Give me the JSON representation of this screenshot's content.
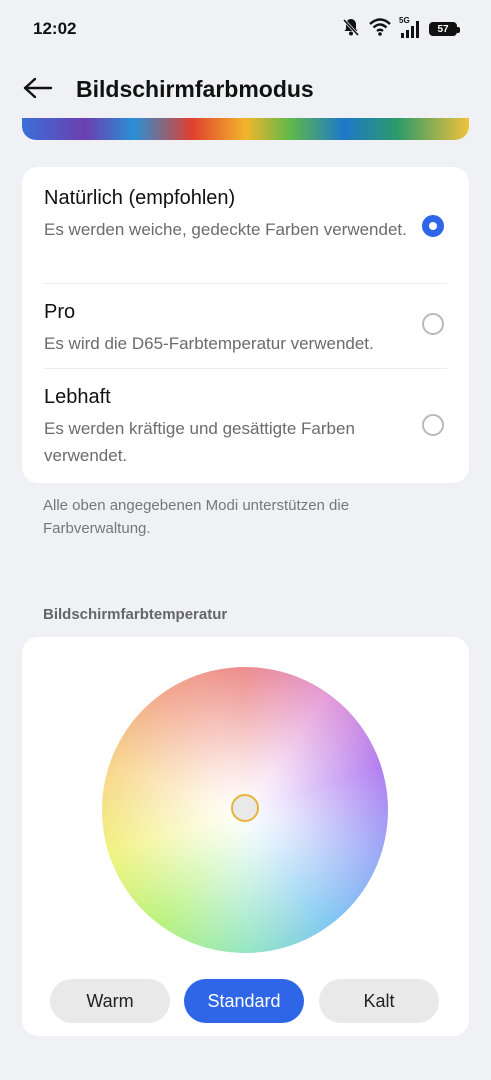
{
  "status": {
    "time": "12:02",
    "network": "5G",
    "battery": "57"
  },
  "header": {
    "title": "Bildschirmfarbmodus"
  },
  "modes": [
    {
      "title": "Natürlich (empfohlen)",
      "description": "Es werden weiche, gedeckte Farben verwendet.",
      "selected": true
    },
    {
      "title": "Pro",
      "description": "Es wird die D65-Farbtemperatur verwendet.",
      "selected": false
    },
    {
      "title": "Lebhaft",
      "description": "Es werden kräftige und gesättigte Farben verwendet.",
      "selected": false
    }
  ],
  "note": "Alle oben angegebenen Modi unterstützen die Farbverwaltung.",
  "temperature": {
    "section_label": "Bildschirmfarbtemperatur",
    "buttons": [
      "Warm",
      "Standard",
      "Kalt"
    ],
    "active_button": "Standard"
  },
  "colors": {
    "accent": "#2f66e8",
    "background": "#f0f1f4",
    "card": "#ffffff"
  },
  "icons": {
    "back": "arrow-left-icon",
    "mute": "bell-off-icon",
    "wifi": "wifi-icon",
    "signal": "signal-icon",
    "battery": "battery-icon"
  }
}
